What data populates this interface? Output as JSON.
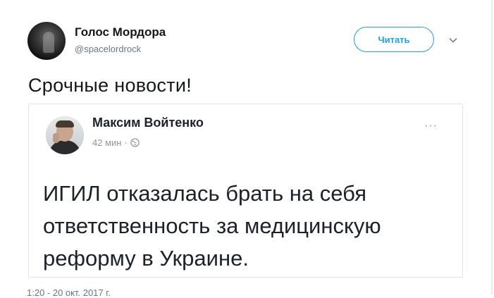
{
  "tweet": {
    "display_name": "Голос Мордора",
    "handle": "@spacelordrock",
    "follow_label": "Читать",
    "text": "Срочные новости!",
    "timestamp": "1:20 - 20 окт. 2017 г."
  },
  "embed": {
    "author": "Максим Войтенко",
    "time": "42 мин",
    "separator": "·",
    "more": "···",
    "text": "ИГИЛ отказалась брать на себя ответственность за медицинскую реформу в Украине."
  },
  "colors": {
    "accent": "#1da1f2",
    "muted": "#657786",
    "card_border": "#dfe3e8"
  },
  "icons": {
    "caret": "chevron-down-icon",
    "globe": "globe-icon",
    "more": "more-options-icon"
  }
}
